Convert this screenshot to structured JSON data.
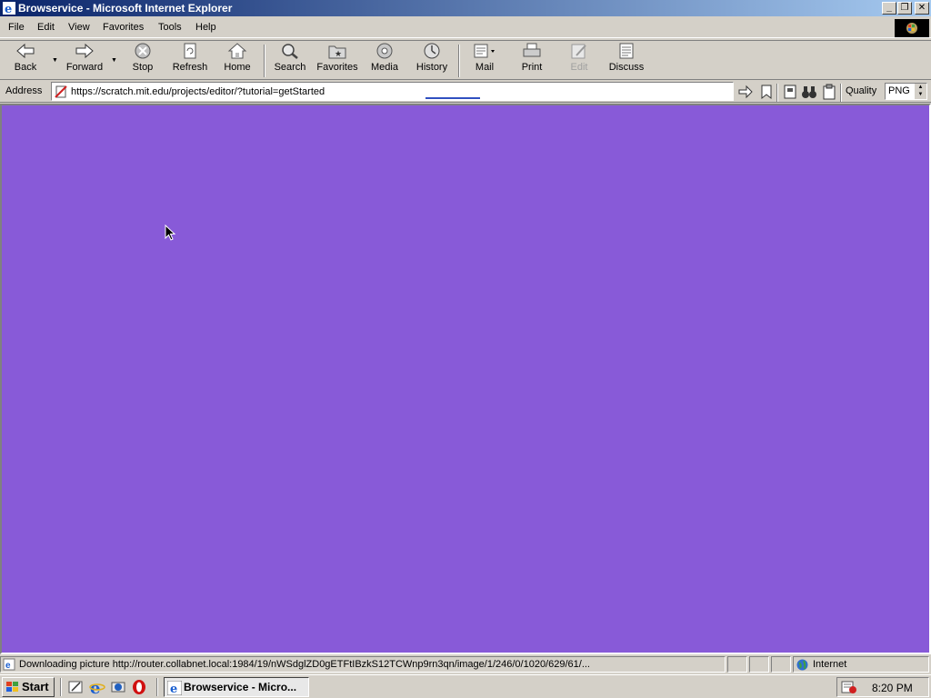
{
  "window": {
    "title": "Browservice - Microsoft Internet Explorer",
    "minimize": "_",
    "restore": "❐",
    "close": "✕"
  },
  "menu": [
    {
      "label": "File"
    },
    {
      "label": "Edit"
    },
    {
      "label": "View"
    },
    {
      "label": "Favorites"
    },
    {
      "label": "Tools"
    },
    {
      "label": "Help"
    }
  ],
  "toolbar": {
    "back": "Back",
    "forward": "Forward",
    "stop": "Stop",
    "refresh": "Refresh",
    "home": "Home",
    "search": "Search",
    "favorites": "Favorites",
    "media": "Media",
    "history": "History",
    "mail": "Mail",
    "print": "Print",
    "edit": "Edit",
    "discuss": "Discuss"
  },
  "address": {
    "label": "Address",
    "url": "https://scratch.mit.edu/projects/editor/?tutorial=getStarted",
    "quality_label": "Quality",
    "quality_value": "PNG"
  },
  "content": {
    "background": "#885ad8"
  },
  "status": {
    "text": "Downloading picture http://router.collabnet.local:1984/19/nWSdglZD0gETFtIBzkS12TCWnp9rn3qn/image/1/246/0/1020/629/61/...",
    "zone": "Internet"
  },
  "taskbar": {
    "start": "Start",
    "task": "Browservice - Micro...",
    "clock": "8:20 PM"
  }
}
